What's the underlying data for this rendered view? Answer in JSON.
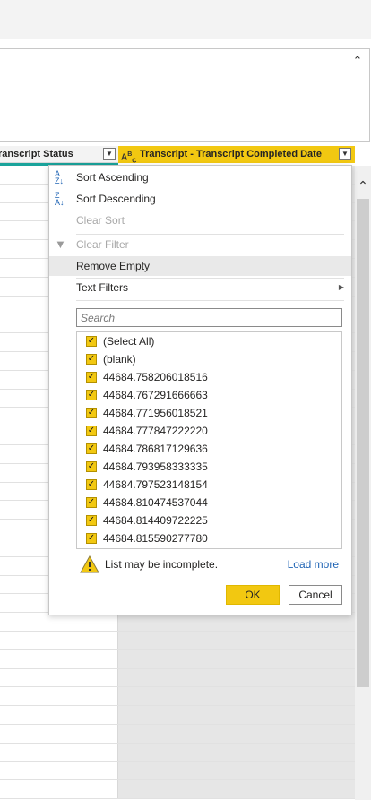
{
  "grid": {
    "headers": {
      "status": "ranscript Status",
      "date": "Transcript - Transcript Completed Date",
      "date_type_icon": "ABC"
    },
    "row_count": 34
  },
  "menu": {
    "sort_ascending": "Sort Ascending",
    "sort_descending": "Sort Descending",
    "clear_sort": "Clear Sort",
    "clear_filter": "Clear Filter",
    "remove_empty": "Remove Empty",
    "text_filters": "Text Filters",
    "search_placeholder": "Search",
    "items": [
      "(Select All)",
      "(blank)",
      "44684.758206018516",
      "44684.767291666663",
      "44684.771956018521",
      "44684.777847222220",
      "44684.786817129636",
      "44684.793958333335",
      "44684.797523148154",
      "44684.810474537044",
      "44684.814409722225",
      "44684.815590277780"
    ],
    "warning": "List may be incomplete.",
    "load_more": "Load more",
    "ok": "OK",
    "cancel": "Cancel"
  },
  "colors": {
    "accent": "#f2c811",
    "link": "#1e63b4",
    "teal": "#1aa39b"
  }
}
